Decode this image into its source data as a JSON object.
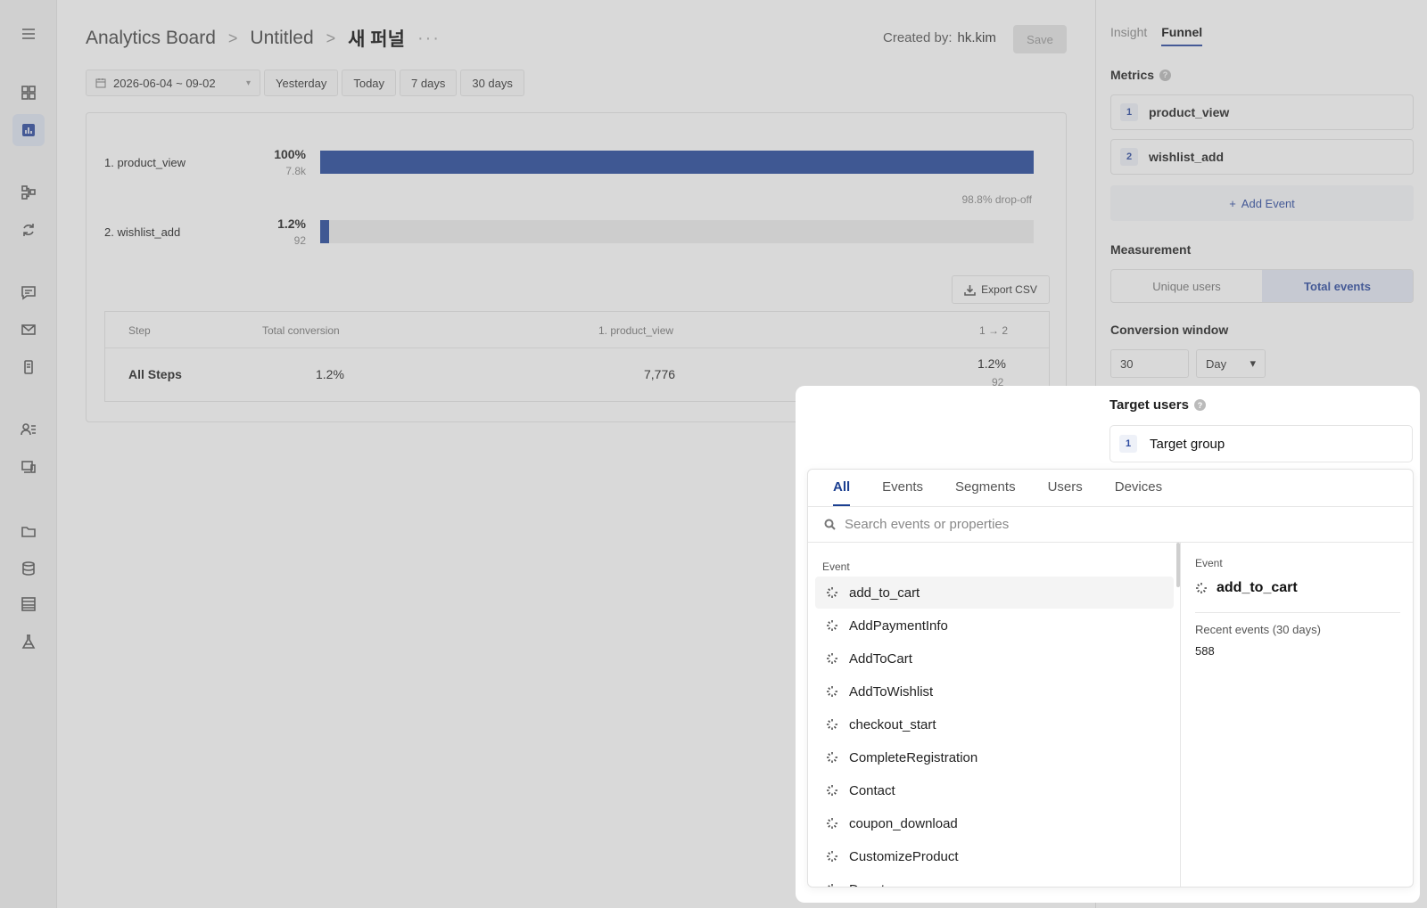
{
  "breadcrumb": {
    "root": "Analytics Board",
    "sep": ">",
    "middle": "Untitled",
    "current": "새 퍼널",
    "more": "···"
  },
  "header": {
    "created_label": "Created by:",
    "created_by": "hk.kim",
    "save_label": "Save"
  },
  "datebar": {
    "range": "2026-06-04 ~ 09-02",
    "quick": [
      "Yesterday",
      "Today",
      "7 days",
      "30 days"
    ]
  },
  "funnel": {
    "steps": [
      {
        "label": "1. product_view",
        "pct": "100%",
        "count": "7.8k",
        "fraction": 1.0
      },
      {
        "label": "2. wishlist_add",
        "pct": "1.2%",
        "count": "92",
        "fraction": 0.012
      }
    ],
    "dropoff": "98.8% drop-off",
    "export_label": "Export CSV"
  },
  "table": {
    "headers": [
      "Step",
      "Total conversion",
      "1. product_view",
      "1 → 2"
    ],
    "row": {
      "step": "All Steps",
      "total": "1.2%",
      "first": "7,776",
      "conv_pct": "1.2%",
      "conv_count": "92"
    }
  },
  "panel": {
    "tabs": [
      "Insight",
      "Funnel"
    ],
    "metrics_title": "Metrics",
    "metrics": [
      {
        "num": "1",
        "name": "product_view"
      },
      {
        "num": "2",
        "name": "wishlist_add"
      }
    ],
    "add_event": "Add Event",
    "measurement_title": "Measurement",
    "measurement": [
      "Unique users",
      "Total events"
    ],
    "conversion_title": "Conversion window",
    "conversion_value": "30",
    "conversion_unit": "Day",
    "target_title": "Target users",
    "target_num": "1",
    "target_group": "Target group"
  },
  "picker": {
    "tabs": [
      "All",
      "Events",
      "Segments",
      "Users",
      "Devices"
    ],
    "search_placeholder": "Search events or properties",
    "category": "Event",
    "items": [
      "add_to_cart",
      "AddPaymentInfo",
      "AddToCart",
      "AddToWishlist",
      "checkout_start",
      "CompleteRegistration",
      "Contact",
      "coupon_download",
      "CustomizeProduct",
      "Donate"
    ],
    "detail": {
      "category": "Event",
      "name": "add_to_cart",
      "recent_label": "Recent events (30 days)",
      "recent_value": "588"
    }
  },
  "colors": {
    "accent": "#23479b",
    "dim_overlay": "rgba(128,128,128,0.30)"
  }
}
